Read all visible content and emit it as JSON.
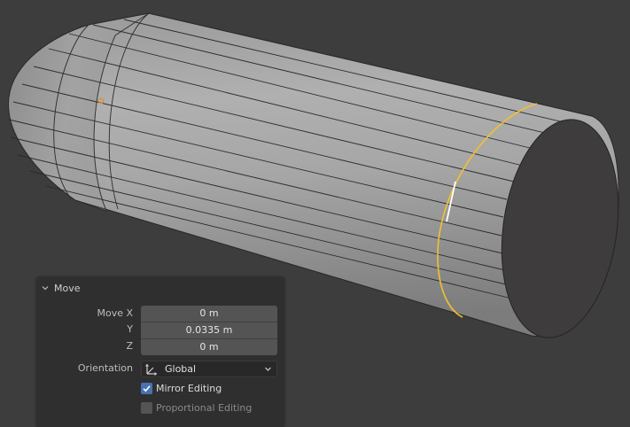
{
  "viewport": {
    "object": "cylinder",
    "selection_color": "#f2c12e",
    "origin_color": "#e8882d",
    "background": "#3d3d3d"
  },
  "operator_panel": {
    "title": "Move",
    "icon": "chevron-down-icon",
    "fields": {
      "move_x_label": "Move X",
      "move_x_value": "0 m",
      "y_label": "Y",
      "y_value": "0.0335 m",
      "z_label": "Z",
      "z_value": "0 m"
    },
    "orientation": {
      "label": "Orientation",
      "value": "Global",
      "icon": "global-orientation-icon"
    },
    "mirror_editing": {
      "label": "Mirror Editing",
      "checked": true
    },
    "proportional_editing": {
      "label": "Proportional Editing",
      "checked": false
    },
    "accent_color": "#4772b3"
  }
}
